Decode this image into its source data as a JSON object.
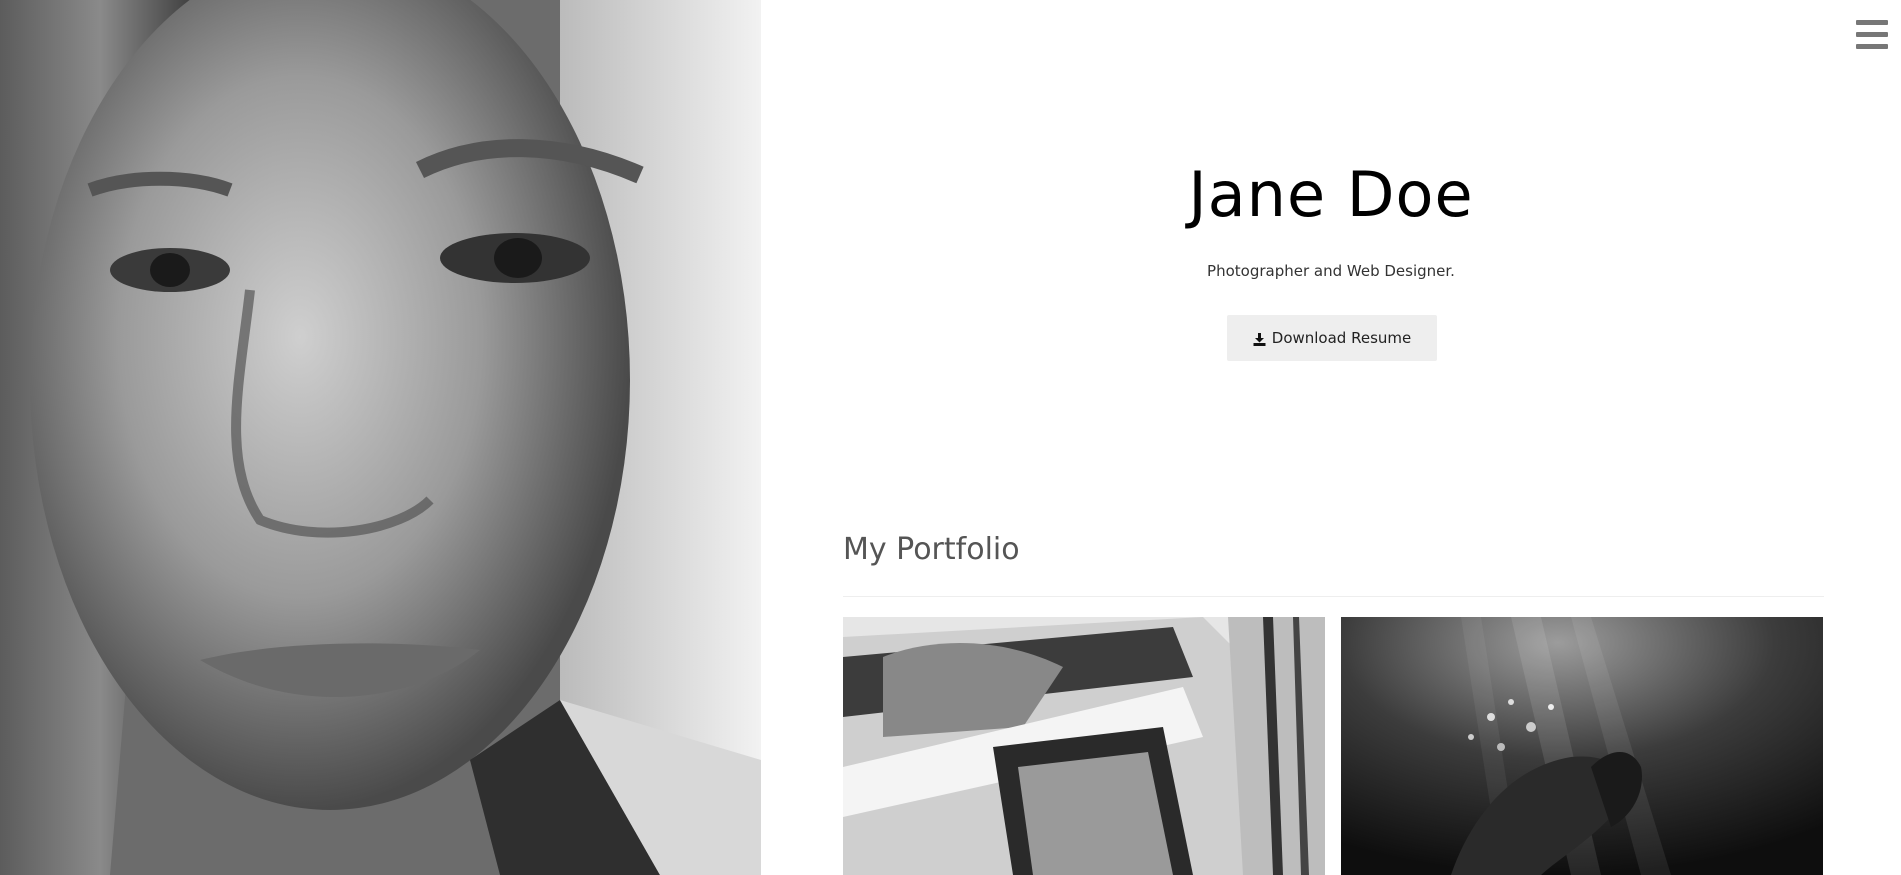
{
  "header": {
    "menu_icon": "hamburger-menu-icon"
  },
  "hero": {
    "name": "Jane Doe",
    "subtitle": "Photographer and Web Designer.",
    "resume_button_label": "Download Resume",
    "resume_button_icon": "download-icon"
  },
  "portfolio": {
    "title": "My Portfolio",
    "items": [
      {
        "subject": "wedding-car-photo"
      },
      {
        "subject": "underwater-photo"
      }
    ]
  },
  "portrait": {
    "subject": "woman-portrait-photo"
  }
}
